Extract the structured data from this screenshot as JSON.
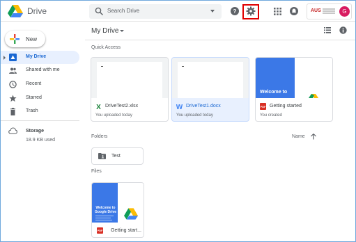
{
  "app": {
    "title": "Drive"
  },
  "search": {
    "placeholder": "Search Drive"
  },
  "account": {
    "org": "AUS",
    "avatar_letter": "G"
  },
  "sidebar": {
    "new_label": "New",
    "items": [
      {
        "label": "My Drive",
        "icon": "my-drive-icon",
        "active": true
      },
      {
        "label": "Shared with me",
        "icon": "people-icon"
      },
      {
        "label": "Recent",
        "icon": "clock-icon"
      },
      {
        "label": "Starred",
        "icon": "star-icon"
      },
      {
        "label": "Trash",
        "icon": "trash-icon"
      }
    ],
    "storage_label": "Storage",
    "storage_used": "18.9 KB used"
  },
  "main": {
    "title": "My Drive",
    "quick_access_label": "Quick Access",
    "quick_access": [
      {
        "name": "DriveTest2.xlsx",
        "sub": "You uploaded today",
        "type": "xlsx",
        "type_color": "#188038"
      },
      {
        "name": "DriveTest1.docx",
        "sub": "You uploaded today",
        "type": "docx",
        "type_color": "#4285f4",
        "selected": true
      },
      {
        "name": "Getting started",
        "sub": "You created",
        "type": "pdf",
        "type_color": "#d93025",
        "thumb_text": "Welcome to"
      }
    ],
    "folders_label": "Folders",
    "sort_label": "Name",
    "folders": [
      {
        "name": "Test"
      }
    ],
    "files_label": "Files",
    "files": [
      {
        "name": "Getting start...",
        "type": "pdf",
        "thumb_text": "Welcome to Google Drive"
      }
    ]
  },
  "colors": {
    "accent": "#1967d2",
    "active_bg": "#e8f0fe",
    "highlight_box": "#e00000",
    "avatar": "#d81b60"
  }
}
